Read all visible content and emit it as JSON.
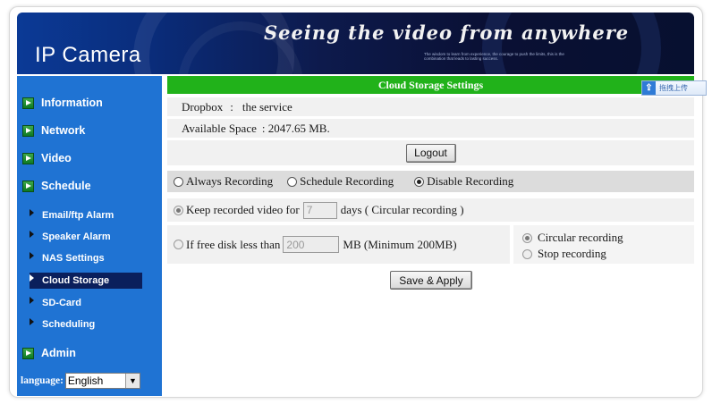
{
  "banner": {
    "logo": "IP Camera",
    "tagline": "Seeing the video from anywhere",
    "fine_print": "The wisdom to learn from experience, the courage to push the limits, this is the combination that leads to lasting success."
  },
  "sidebar": {
    "items": [
      {
        "label": "Information"
      },
      {
        "label": "Network"
      },
      {
        "label": "Video"
      },
      {
        "label": "Schedule"
      },
      {
        "label": "Admin"
      }
    ],
    "sub_items": [
      {
        "label": "Email/ftp Alarm"
      },
      {
        "label": "Speaker Alarm"
      },
      {
        "label": "NAS Settings"
      },
      {
        "label": "Cloud Storage"
      },
      {
        "label": "SD-Card"
      },
      {
        "label": "Scheduling"
      }
    ],
    "language_label": "language:",
    "language_value": "English"
  },
  "main": {
    "title": "Cloud Storage Settings",
    "provider_label": "Dropbox",
    "provider_sep": ":",
    "provider_value": "the service",
    "space_label": "Available Space",
    "space_value": ": 2047.65 MB.",
    "logout_label": "Logout",
    "recording_modes": [
      "Always Recording",
      "Schedule Recording",
      "Disable Recording"
    ],
    "selected_mode": "Disable Recording",
    "keep_label": "Keep recorded video for",
    "keep_days": "7",
    "keep_suffix": "days ( Circular recording )",
    "free_label": "If free disk less than",
    "free_value": "200",
    "free_suffix": "MB (Minimum 200MB)",
    "full_options": [
      "Circular recording",
      "Stop recording"
    ],
    "save_label": "Save & Apply"
  },
  "overlay": {
    "upload_label": "拖拽上传"
  },
  "colors": {
    "sidebar": "#1f73d3",
    "title_bar": "#21b21a",
    "active_item": "#0a1f5c",
    "row_bg": "#f1f1f1",
    "mode_row_bg": "#dcdcdc"
  }
}
